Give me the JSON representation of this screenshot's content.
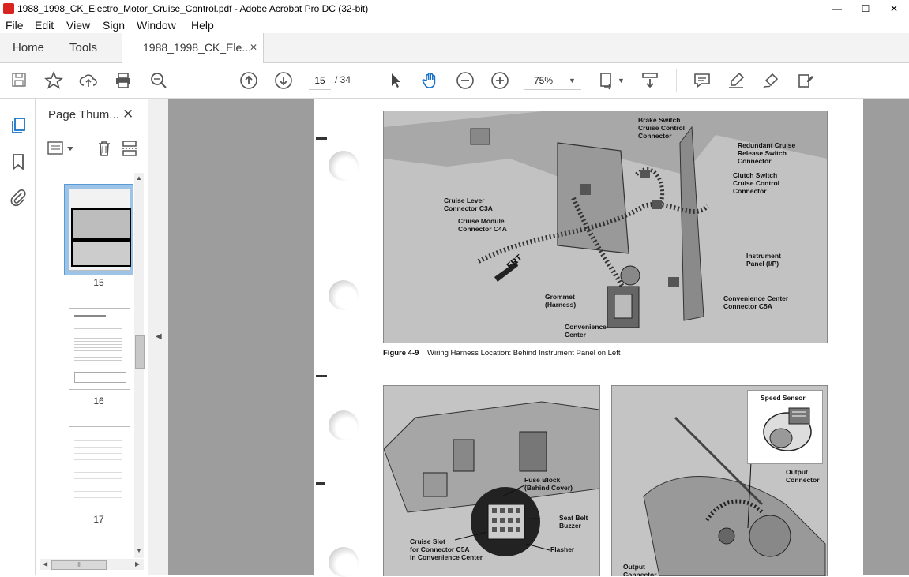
{
  "window": {
    "title": "1988_1998_CK_Electro_Motor_Cruise_Control.pdf - Adobe Acrobat Pro DC (32-bit)",
    "controls": [
      "—",
      "☐",
      "✕"
    ]
  },
  "menu": [
    "File",
    "Edit",
    "View",
    "Sign",
    "Window",
    "Help"
  ],
  "tabs": {
    "home": "Home",
    "tools": "Tools",
    "document": "1988_1998_CK_Ele...",
    "close": "✕"
  },
  "toolbar": {
    "page_current": "15",
    "page_total": "/ 34",
    "zoom": "75%"
  },
  "sidebar": {
    "panel_title": "Page Thum...",
    "close": "✕",
    "thumbnails": [
      {
        "page": "15",
        "selected": true
      },
      {
        "page": "16",
        "selected": false
      },
      {
        "page": "17",
        "selected": false
      }
    ],
    "scroll_grip": "III"
  },
  "document": {
    "figure_top_labels": {
      "brake": "Brake Switch\nCruise Control\nConnector",
      "redundant": "Redundant Cruise\nRelease Switch\nConnector",
      "clutch": "Clutch Switch\nCruise Control\nConnector",
      "lever": "Cruise Lever\nConnector C3A",
      "module": "Cruise Module\nConnector C4A",
      "frt": "FRT",
      "instrument": "Instrument\nPanel (I/P)",
      "grommet": "Grommet\n(Harness)",
      "conv_center_conn": "Convenience Center\nConnector C5A",
      "conv_center": "Convenience\nCenter"
    },
    "caption_label": "Figure 4-9",
    "caption_text": "Wiring Harness Location: Behind Instrument Panel on Left",
    "figure_left_labels": {
      "fuse": "Fuse Block\n(Behind Cover)",
      "seatbelt": "Seat Belt\nBuzzer",
      "cruise_slot": "Cruise Slot\nfor Connector C5A\nin Convenience Center",
      "flasher": "Flasher"
    },
    "figure_right_labels": {
      "speed_sensor": "Speed Sensor",
      "output_conn": "Output\nConnector",
      "output_conn_bottom": "Output\nConnector"
    }
  },
  "colors": {
    "accent_blue": "#1a73c9",
    "doc_bg": "#9d9d9d",
    "pdf_red": "#d9231e"
  }
}
